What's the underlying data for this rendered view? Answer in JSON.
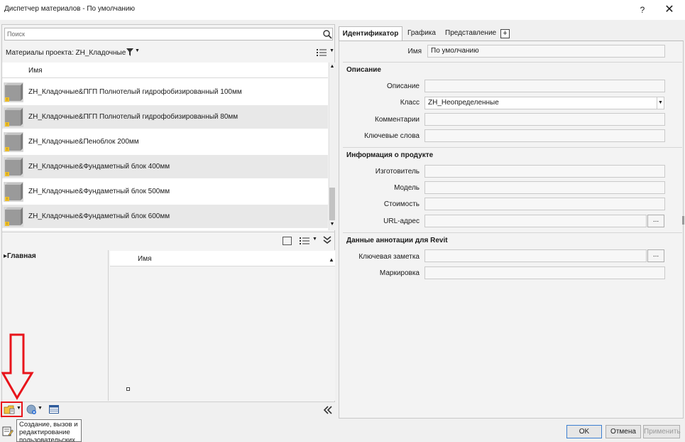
{
  "window": {
    "title": "Диспетчер материалов - По умолчанию",
    "help": "?",
    "close": "✕"
  },
  "left": {
    "search_placeholder": "Поиск",
    "project_materials_label": "Материалы проекта: ZH_Кладочные",
    "list_header": "Имя",
    "materials": [
      "ZH_Кладочные&ПГП Полнотелый гидрофобизированный 100мм",
      "ZH_Кладочные&ПГП Полнотелый гидрофобизированный 80мм",
      "ZH_Кладочные&Пеноблок 200мм",
      "ZH_Кладочные&Фундаметный блок 400мм",
      "ZH_Кладочные&Фундаметный блок 500мм",
      "ZH_Кладочные&Фундаметный блок 600мм"
    ],
    "library_tree_item": "▸Главная",
    "library_header": "Имя",
    "tooltip": "Создание, вызов и редактирование пользовательских"
  },
  "right": {
    "tabs": [
      "Идентификатор",
      "Графика",
      "Представление"
    ],
    "tab_add": "+",
    "name_label": "Имя",
    "name_value": "По умолчанию",
    "sections": {
      "description": "Описание",
      "product_info": "Информация о продукте",
      "revit_annotation": "Данные аннотации для Revit"
    },
    "fields": {
      "description": "Описание",
      "class": "Класс",
      "class_value": "ZH_Неопределенные",
      "comments": "Комментарии",
      "keywords": "Ключевые слова",
      "manufacturer": "Изготовитель",
      "model": "Модель",
      "cost": "Стоимость",
      "url": "URL-адрес",
      "keynote": "Ключевая заметка",
      "mark": "Маркировка"
    },
    "browse": "..."
  },
  "footer": {
    "ok": "OK",
    "cancel": "Отмена",
    "apply": "Применить"
  },
  "colors": {
    "highlight_red": "#e8141b",
    "ok_border": "#3c7fd1"
  }
}
